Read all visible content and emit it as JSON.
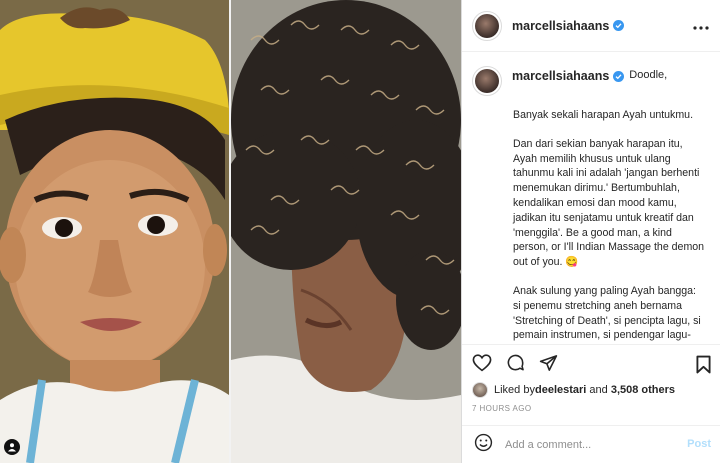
{
  "post": {
    "username": "marcellsiahaans",
    "caption": {
      "first": "Doodle,",
      "paragraphs": [
        "Banyak sekali harapan Ayah untukmu.",
        "Dan dari sekian banyak harapan itu, Ayah memilih khusus untuk ulang tahunmu kali ini adalah 'jangan berhenti menemukan dirimu.' Bertumbuhlah, kendalikan emosi dan mood kamu, jadikan itu senjatamu untuk kreatif dan 'menggila'. Be a good man, a kind person, or I'll Indian Massage the demon out of you. 😋",
        "Anak sulung yang paling Ayah bangga: si penemu stretching aneh bernama 'Stretching of Death', si pencipta lagu, si pemain instrumen, si pendengar lagu-lagu indie aneh, si rambut ajaib, dan si-si lainnya."
      ]
    },
    "likes": {
      "prefix": "Liked by ",
      "user": "deelestari",
      "connector": " and ",
      "count": "3,508 others"
    },
    "time": "7 HOURS AGO"
  },
  "comment_box": {
    "placeholder": "Add a comment...",
    "post_label": "Post"
  },
  "icons": [
    "more-icon",
    "verified-icon",
    "heart-icon",
    "comment-icon",
    "share-icon",
    "bookmark-icon",
    "emoji-icon",
    "user-tag-icon"
  ],
  "colors": {
    "verified": "#3897f0",
    "post_disabled": "#b2dffc",
    "muted": "#8e8e8e"
  }
}
